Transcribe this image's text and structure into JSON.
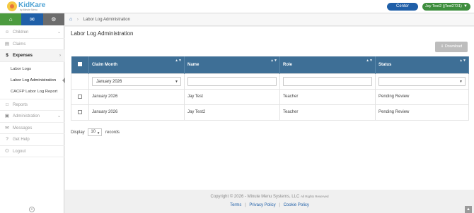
{
  "header": {
    "logo_text": "KidKare",
    "logo_sub": "by Minute Menu",
    "center_label": "Center",
    "user_label": "Jay Test2 (jTest2731)"
  },
  "sidebar": {
    "items": [
      {
        "label": "Children",
        "icon": "child-icon",
        "arrow": "chevron-down"
      },
      {
        "label": "Claims",
        "icon": "claims-icon"
      },
      {
        "label": "Expenses",
        "icon": "dollar-icon",
        "arrow": "chevron-right"
      },
      {
        "label": "Reports",
        "icon": "report-icon"
      },
      {
        "label": "Administration",
        "icon": "briefcase-icon",
        "arrow": "chevron-down"
      },
      {
        "label": "Messages",
        "icon": "envelope-icon"
      },
      {
        "label": "Get Help",
        "icon": "help-icon"
      },
      {
        "label": "Logout",
        "icon": "power-icon"
      }
    ],
    "expenses_sub": [
      "Labor Logs",
      "Labor Log Administration",
      "CACFP Labor Log Report"
    ]
  },
  "breadcrumb": {
    "current": "Labor Log Administration"
  },
  "page": {
    "title": "Labor Log Administration",
    "download_label": "Download"
  },
  "grid": {
    "columns": [
      "Claim Month",
      "Name",
      "Role",
      "Status"
    ],
    "filters": {
      "claim_month": "January 2026",
      "name": "",
      "role": "",
      "status": ""
    },
    "rows": [
      {
        "claim_month": "January 2026",
        "name": "Jay Test",
        "role": "Teacher",
        "status": "Pending Review"
      },
      {
        "claim_month": "January 2026",
        "name": "Jay Test2",
        "role": "Teacher",
        "status": "Pending Review"
      }
    ]
  },
  "pager": {
    "display_label": "Display",
    "page_size": "10",
    "records_label": "records"
  },
  "footer": {
    "copyright": "Copyright © 2026 - Minute Menu Systems, LLC",
    "rights": "All Rights Reserved",
    "links": [
      "Terms",
      "Privacy Policy",
      "Cookie Policy"
    ]
  },
  "colors": {
    "header_green": "#4c9b3f",
    "header_blue": "#1f5fa8",
    "grid_header": "#3e6f96",
    "user_badge": "#3e8e3e"
  }
}
